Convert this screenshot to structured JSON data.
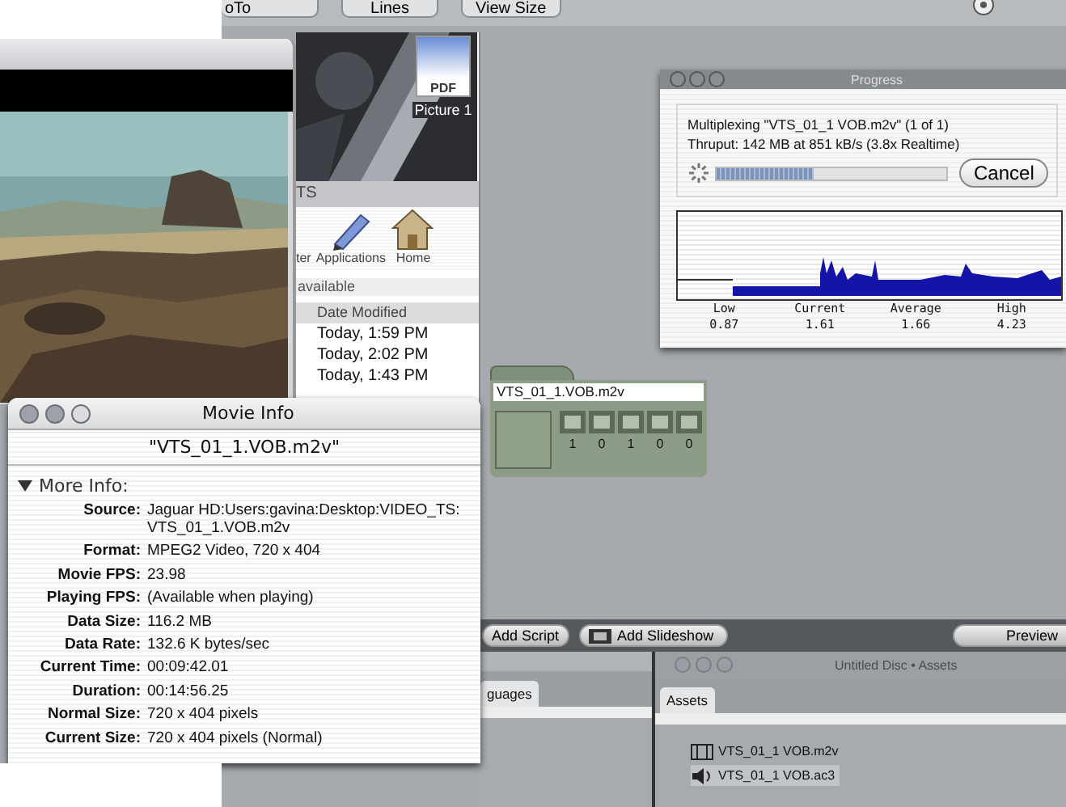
{
  "toolbar": {
    "popups": [
      "oTo",
      "Lines",
      "View Size"
    ]
  },
  "finder_window": {
    "desktop_icon": {
      "badge": "PDF",
      "label": "Picture 1"
    },
    "title": "TS",
    "toolbar_items": [
      {
        "kind": "text",
        "label": "ter"
      },
      {
        "kind": "applications",
        "label": "Applications"
      },
      {
        "kind": "home",
        "label": "Home"
      }
    ],
    "status": "available",
    "column": "Date Modified",
    "rows": [
      "Today, 1:59 PM",
      "Today, 2:02 PM",
      "Today, 1:43 PM"
    ]
  },
  "progress_window": {
    "title": "Progress",
    "message": "Multiplexing \"VTS_01_1 VOB.m2v\" (1 of 1)",
    "throughput": "Thruput: 142 MB at 851 kB/s (3.8x Realtime)",
    "level": 0.42,
    "cancel": "Cancel",
    "stats": [
      {
        "label": "Low",
        "value": "0.87"
      },
      {
        "label": "Current",
        "value": "1.61"
      },
      {
        "label": "Average",
        "value": "1.66"
      },
      {
        "label": "High",
        "value": "4.23"
      }
    ]
  },
  "track_tile": {
    "name": "VTS_01_1.VOB.m2v",
    "counts": [
      "1",
      "0",
      "1",
      "0",
      "0"
    ]
  },
  "movie_info": {
    "title": "Movie Info",
    "file": "\"VTS_01_1.VOB.m2v\"",
    "section": "More Info:",
    "expanded": true,
    "fields": [
      {
        "label": "Source:",
        "value": "Jaguar HD:Users:gavina:Desktop:VIDEO_TS:VTS_01_1.VOB.m2v"
      },
      {
        "label": "Format:",
        "value": "MPEG2 Video, 720 x 404"
      },
      {
        "label": "Movie FPS:",
        "value": "23.98"
      },
      {
        "label": "Playing FPS:",
        "value": "(Available when playing)"
      },
      {
        "label": "Data Size:",
        "value": "116.2 MB"
      },
      {
        "label": "Data Rate:",
        "value": "132.6 K bytes/sec"
      },
      {
        "label": "Current Time:",
        "value": "00:09:42.01"
      },
      {
        "label": "Duration:",
        "value": "00:14:56.25"
      },
      {
        "label": "Normal Size:",
        "value": "720 x 404 pixels"
      },
      {
        "label": "Current Size:",
        "value": "720 x 404 pixels (Normal)"
      }
    ]
  },
  "bottom_bar": {
    "buttons": [
      "Add Script",
      "Add Slideshow",
      "Preview"
    ]
  },
  "left_panel": {
    "tabs": [
      {
        "label": "guages",
        "selected": true
      }
    ]
  },
  "assets_window": {
    "title": "Untitled Disc • Assets",
    "tabs": [
      {
        "label": "Assets",
        "selected": true
      }
    ],
    "items": [
      {
        "kind": "video",
        "name": "VTS_01_1 VOB.m2v",
        "selected": false
      },
      {
        "kind": "audio",
        "name": "VTS_01_1 VOB.ac3",
        "selected": true
      }
    ]
  }
}
